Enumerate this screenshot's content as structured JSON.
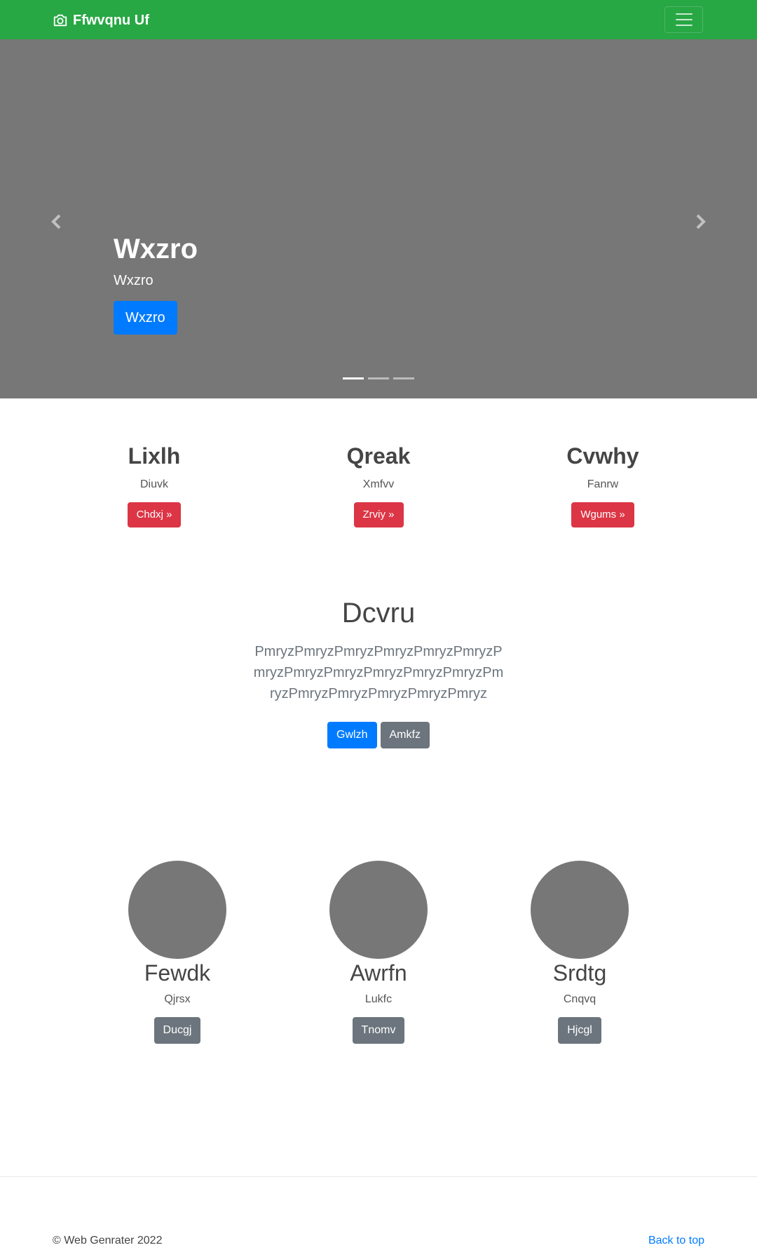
{
  "navbar": {
    "brand": "Ffwvqnu Uf",
    "brand_icon": "camera-icon",
    "toggler_icon": "hamburger-menu-icon",
    "background": "#28a745"
  },
  "hero": {
    "background": "#777777",
    "title": "Wxzro",
    "subtitle": "Wxzro",
    "button": "Wxzro",
    "indicators": 3,
    "active_indicator": 0
  },
  "features": [
    {
      "title": "Lixlh",
      "text": "Diuvk",
      "button": "Chdxj »"
    },
    {
      "title": "Qreak",
      "text": "Xmfvv",
      "button": "Zrviy »"
    },
    {
      "title": "Cvwhy",
      "text": "Fanrw",
      "button": "Wgums »"
    }
  ],
  "jumbotron": {
    "title": "Dcvru",
    "lead": "PmryzPmryzPmryzPmryzPmryzPmryzPmryzPmryzPmryzPmryzPmryzPmryzPmryzPmryzPmryzPmryzPmryzPmryz",
    "primary_button": "Gwlzh",
    "secondary_button": "Amkfz"
  },
  "people": [
    {
      "name": "Fewdk",
      "text": "Qjrsx",
      "button": "Ducgj"
    },
    {
      "name": "Awrfn",
      "text": "Lukfc",
      "button": "Tnomv"
    },
    {
      "name": "Srdtg",
      "text": "Cnqvq",
      "button": "Hjcgl"
    }
  ],
  "footer": {
    "copyright": "© Web Genrater 2022",
    "back_to_top": "Back to top"
  },
  "colors": {
    "primary": "#007bff",
    "danger": "#dc3545",
    "secondary": "#6c757d",
    "success": "#28a745"
  }
}
